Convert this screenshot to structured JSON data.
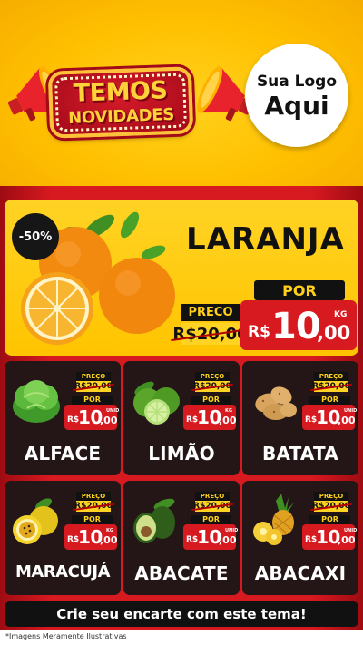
{
  "header": {
    "badge_line1": "TEMOS",
    "badge_line2": "NOVIDADES",
    "logo_line1": "Sua Logo",
    "logo_line2": "Aqui"
  },
  "featured": {
    "discount": "-50%",
    "name": "LARANJA",
    "preco_label": "PRECO",
    "old_price": "R$20,00",
    "por_label": "POR",
    "currency": "R$",
    "price_int": "10",
    "price_dec": ",00",
    "unit": "KG",
    "icon": "orange-icon"
  },
  "products": [
    {
      "name": "ALFACE",
      "preco_label": "PREÇO",
      "old_price": "R$20,00",
      "por_label": "POR",
      "currency": "R$",
      "price_int": "10",
      "price_dec": ",00",
      "unit": "UNID",
      "icon": "lettuce-icon"
    },
    {
      "name": "LIMÃO",
      "preco_label": "PREÇO",
      "old_price": "R$20,00",
      "por_label": "POR",
      "currency": "R$",
      "price_int": "10",
      "price_dec": ",00",
      "unit": "KG",
      "icon": "lime-icon"
    },
    {
      "name": "BATATA",
      "preco_label": "PREÇO",
      "old_price": "R$20,00",
      "por_label": "POR",
      "currency": "R$",
      "price_int": "10",
      "price_dec": ",00",
      "unit": "UNID",
      "icon": "potato-icon"
    },
    {
      "name": "MARACUJÁ",
      "preco_label": "PREÇO",
      "old_price": "R$20,00",
      "por_label": "POR",
      "currency": "R$",
      "price_int": "10",
      "price_dec": ",00",
      "unit": "KG",
      "icon": "passion-fruit-icon"
    },
    {
      "name": "ABACATE",
      "preco_label": "PREÇO",
      "old_price": "R$20,00",
      "por_label": "POR",
      "currency": "R$",
      "price_int": "10",
      "price_dec": ",00",
      "unit": "UNID",
      "icon": "avocado-icon"
    },
    {
      "name": "ABACAXI",
      "preco_label": "PREÇO",
      "old_price": "R$20,00",
      "por_label": "POR",
      "currency": "R$",
      "price_int": "10",
      "price_dec": ",00",
      "unit": "UNID",
      "icon": "pineapple-icon"
    }
  ],
  "cta": "Crie seu encarte com este tema!",
  "footer_note": "*Imagens Meramente Ilustrativas",
  "colors": {
    "yellow": "#ffc400",
    "red": "#d71920",
    "dark": "#241616",
    "black": "#111111"
  }
}
